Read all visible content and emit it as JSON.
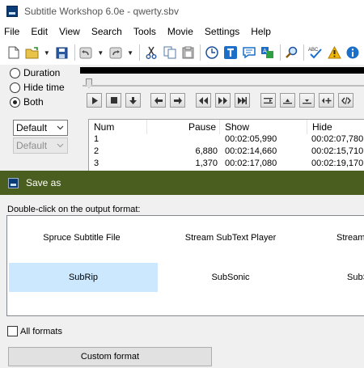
{
  "window": {
    "title": "Subtitle Workshop 6.0e - qwerty.sbv"
  },
  "menu": [
    "File",
    "Edit",
    "View",
    "Search",
    "Tools",
    "Movie",
    "Settings",
    "Help"
  ],
  "toolbar": {
    "icons": [
      "new-file-icon",
      "open-folder-icon",
      "dropdown-arrow-icon",
      "save-icon",
      "undo-icon",
      "redo-icon",
      "cut-icon",
      "copy-icon",
      "paste-icon",
      "clock-icon",
      "text-t-icon",
      "speech-bubble-icon",
      "translate-icon",
      "search-magnifier-icon",
      "spellcheck-icon",
      "warning-icon",
      "info-icon"
    ],
    "spellcheck_label": "ABC"
  },
  "time_mode": {
    "options": [
      "Duration",
      "Hide time",
      "Both"
    ],
    "selected": "Both"
  },
  "encoding": {
    "select1": "Default",
    "select2": "Default"
  },
  "subtitles": {
    "columns": [
      "Num",
      "Pause",
      "Show",
      "Hide"
    ],
    "rows": [
      {
        "num": "1",
        "pause": "",
        "show": "00:02:05,990",
        "hide": "00:02:07,780"
      },
      {
        "num": "2",
        "pause": "6,880",
        "show": "00:02:14,660",
        "hide": "00:02:15,710"
      },
      {
        "num": "3",
        "pause": "1,370",
        "show": "00:02:17,080",
        "hide": "00:02:19,170"
      }
    ]
  },
  "dialog": {
    "title": "Save as",
    "instruction": "Double-click on the output format:",
    "formats": [
      "Spruce Subtitle File",
      "Stream SubText Player",
      "Stream",
      "SubRip",
      "SubSonic",
      "SubS"
    ],
    "selected_format": "SubRip",
    "all_formats_label": "All formats",
    "all_formats_checked": false,
    "custom_format_label": "Custom format"
  },
  "colors": {
    "dialog_titlebar": "#4a5e1f",
    "selection": "#cce8ff"
  }
}
